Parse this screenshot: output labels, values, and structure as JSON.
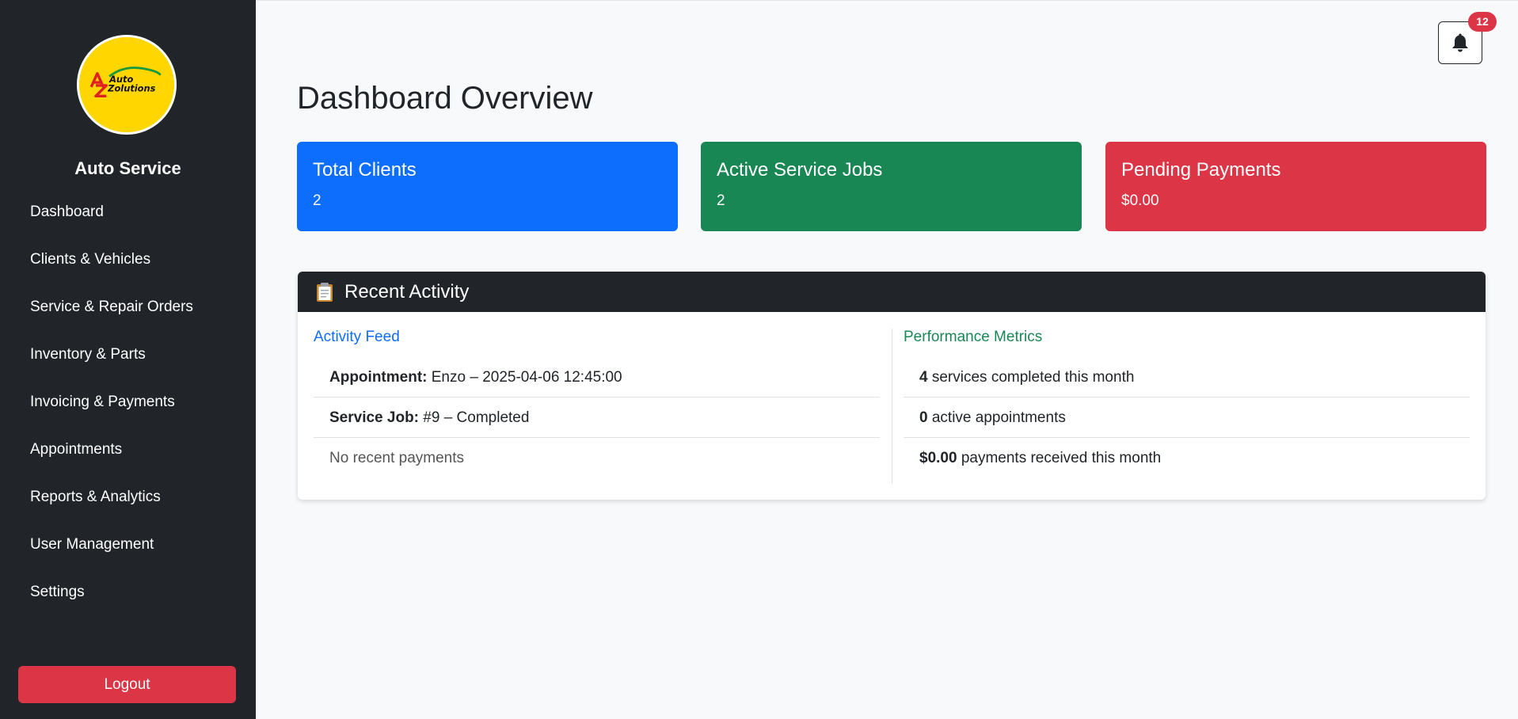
{
  "sidebar": {
    "logo_text_top": "Auto",
    "logo_text_bottom": "Zolutions",
    "brand": "Auto Service",
    "items": [
      {
        "label": "Dashboard"
      },
      {
        "label": "Clients & Vehicles"
      },
      {
        "label": "Service & Repair Orders"
      },
      {
        "label": "Inventory & Parts"
      },
      {
        "label": "Invoicing & Payments"
      },
      {
        "label": "Appointments"
      },
      {
        "label": "Reports & Analytics"
      },
      {
        "label": "User Management"
      },
      {
        "label": "Settings"
      }
    ],
    "logout_label": "Logout"
  },
  "notifications": {
    "count": "12",
    "icon": "bell-icon"
  },
  "page": {
    "title": "Dashboard Overview"
  },
  "cards": [
    {
      "title": "Total Clients",
      "value": "2",
      "color": "#0d6efd"
    },
    {
      "title": "Active Service Jobs",
      "value": "2",
      "color": "#198754"
    },
    {
      "title": "Pending Payments",
      "value": "$0.00",
      "color": "#dc3545"
    }
  ],
  "activity": {
    "title": "Recent Activity",
    "icon": "clipboard-icon",
    "feed": {
      "heading": "Activity Feed",
      "color": "#0d6efd",
      "items": [
        {
          "label": "Appointment:",
          "text": " Enzo – 2025-04-06 12:45:00"
        },
        {
          "label": "Service Job:",
          "text": " #9 – Completed"
        },
        {
          "text": "No recent payments"
        }
      ]
    },
    "metrics": {
      "heading": "Performance Metrics",
      "color": "#198754",
      "items": [
        {
          "value": "4",
          "text": " services completed this month"
        },
        {
          "value": "0",
          "text": " active appointments"
        },
        {
          "value": "$0.00",
          "text": " payments received this month"
        }
      ]
    }
  }
}
